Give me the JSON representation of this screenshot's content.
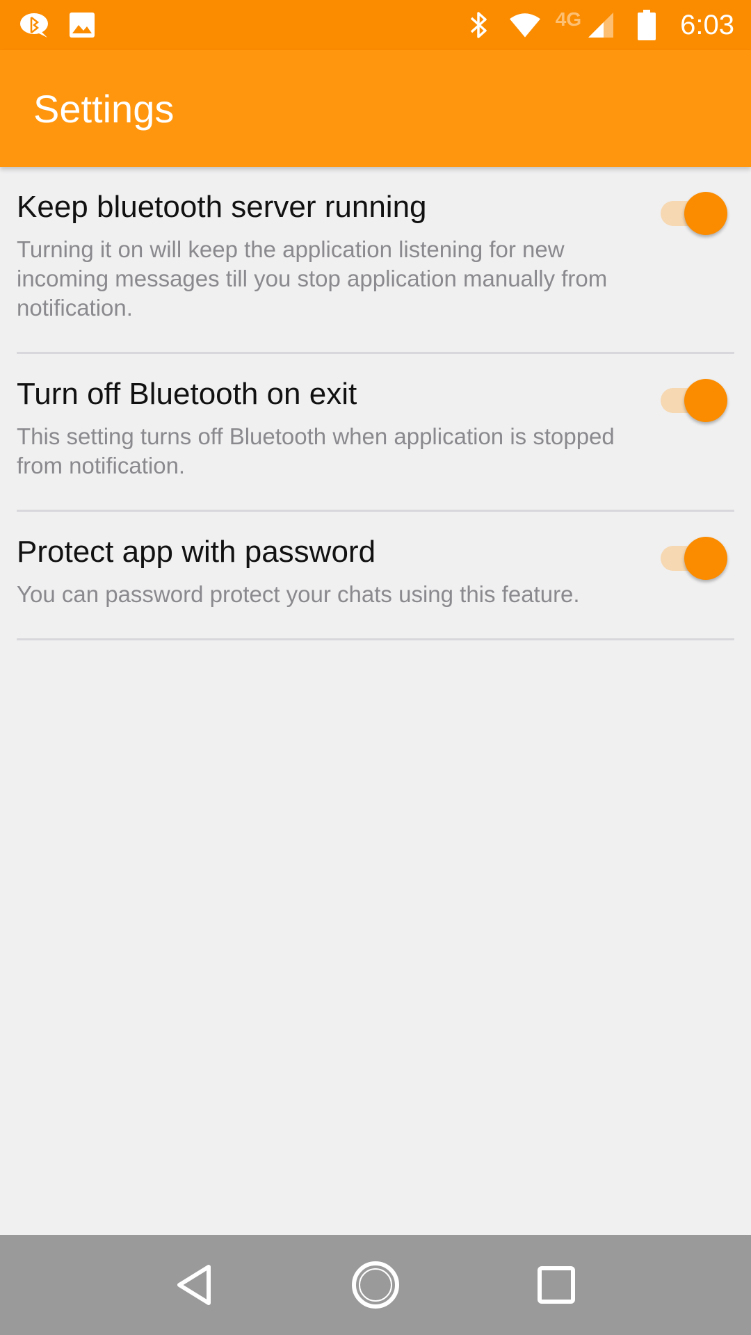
{
  "status_bar": {
    "network_label": "4G",
    "time": "6:03",
    "icons": [
      "chat-bubble-icon",
      "image-icon",
      "bluetooth-icon",
      "wifi-icon",
      "signal-icon",
      "battery-icon"
    ]
  },
  "app_bar": {
    "title": "Settings",
    "color": "#ff960e"
  },
  "settings": [
    {
      "title": "Keep bluetooth server running",
      "summary": "Turning it on will keep the application listening for new incoming messages till you stop application manually from notification.",
      "enabled": true
    },
    {
      "title": "Turn off Bluetooth on exit",
      "summary": "This setting turns off Bluetooth when application is stopped from notification.",
      "enabled": true
    },
    {
      "title": "Protect app with password",
      "summary": "You can password protect your chats using this feature.",
      "enabled": true
    }
  ],
  "nav_bar": {
    "buttons": [
      "back-icon",
      "home-icon",
      "recents-icon"
    ]
  },
  "colors": {
    "accent": "#fb8c00",
    "switch_track": "#f6d8b2",
    "background": "#f0f0f1"
  }
}
